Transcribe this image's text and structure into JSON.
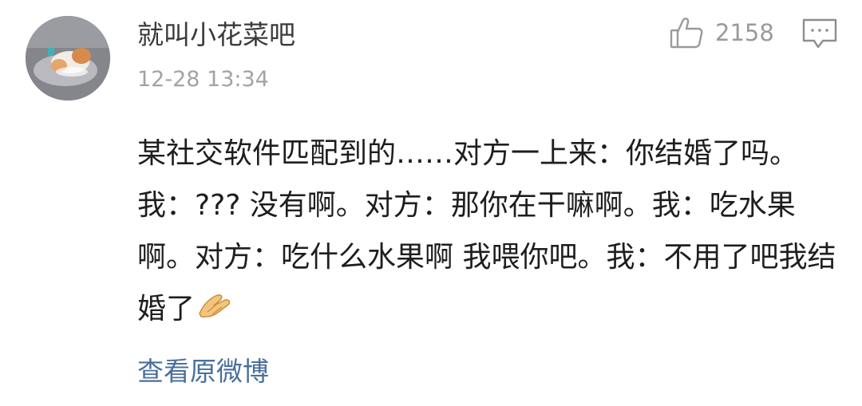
{
  "comment": {
    "username": "就叫小花菜吧",
    "timestamp": "12-28 13:34",
    "like_count": "2158",
    "text": "某社交软件匹配到的……对方一上来：你结婚了吗。我：??? 没有啊。对方：那你在干嘛啊。我：吃水果啊。对方：吃什么水果啊 我喂你吧。我：不用了吧我结婚了",
    "emoji": "pray-hands-emoji",
    "view_original_label": "查看原微博"
  },
  "icons": {
    "like": "thumbs-up-icon",
    "comment": "comment-bubble-icon",
    "avatar": "cat-avatar"
  },
  "colors": {
    "link": "#4a6f9c",
    "meta": "#a3a3a3",
    "text": "#1e1e1e"
  }
}
